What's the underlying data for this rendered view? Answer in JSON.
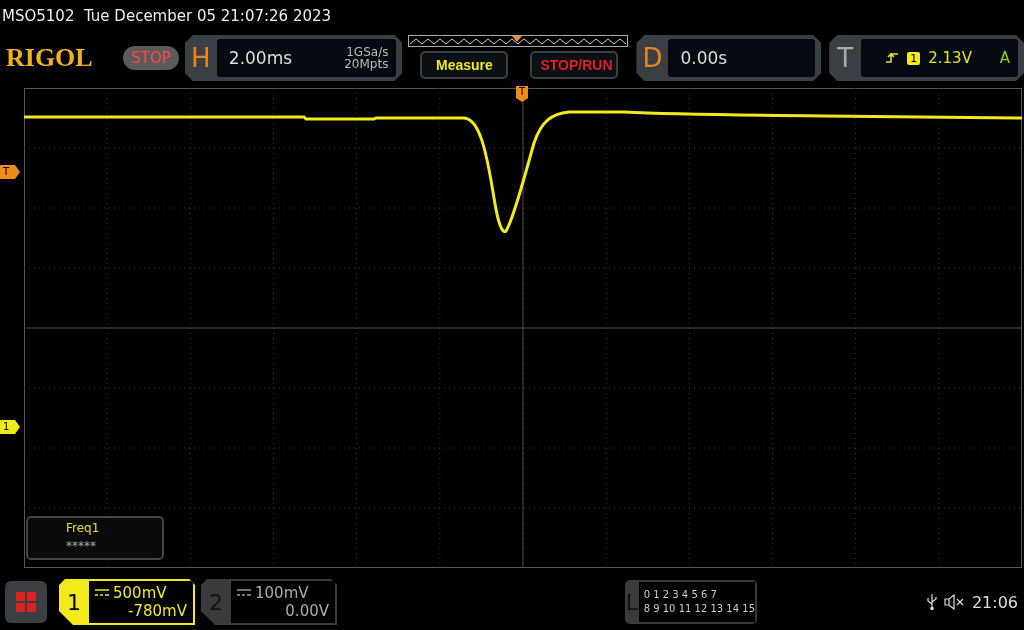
{
  "title": "MSO5102  Tue December 05 21:07:26 2023",
  "logo": "RIGOL",
  "run_state": "STOP",
  "horizontal": {
    "letter": "H",
    "timebase": "2.00ms",
    "sample_rate": "1GSa/s",
    "memory_depth": "20Mpts"
  },
  "buttons": [
    {
      "label": "Measure",
      "kind": "measure"
    },
    {
      "label": "STOP/RUN",
      "kind": "run"
    }
  ],
  "delay": {
    "letter": "D",
    "value": "0.00s"
  },
  "trigger": {
    "letter": "T",
    "source": "1",
    "level": "2.13V",
    "mode": "A"
  },
  "trigger_position_marker": "T",
  "markers": [
    {
      "label": "T",
      "kind": "trigger"
    },
    {
      "label": "1",
      "kind": "channel"
    }
  ],
  "measurement": {
    "name": "Freq1",
    "value": "*****"
  },
  "channels": [
    {
      "number": "1",
      "scale": "500mV",
      "offset": "-780mV",
      "selected": true
    },
    {
      "number": "2",
      "scale": "100mV",
      "offset": "0.00V",
      "selected": false
    }
  ],
  "logic": {
    "letter": "L",
    "rows": [
      "0 1 2 3  4 5 6 7",
      "8 9 10 11 12 13 14 15"
    ]
  },
  "clock": "21:06"
}
